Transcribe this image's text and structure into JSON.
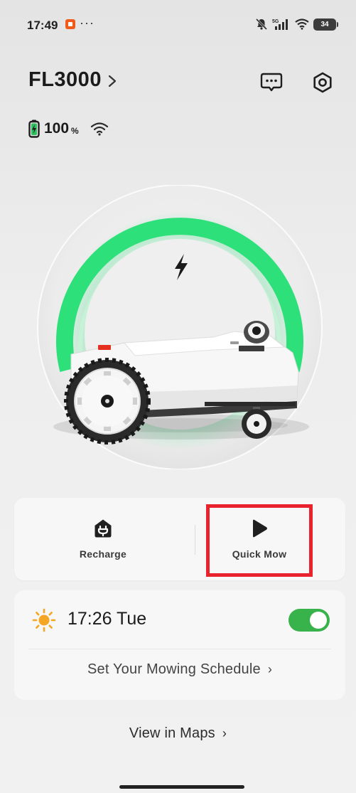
{
  "status_bar": {
    "time": "17:49",
    "overflow": "···",
    "network": "5G",
    "battery": "34"
  },
  "device": {
    "name": "FL3000",
    "chevron": "›",
    "battery_percent": "100",
    "battery_unit": "%",
    "battery_level": 1.0,
    "accent_color": "#2ee07a"
  },
  "actions": {
    "recharge_label": "Recharge",
    "quick_mow_label": "Quick Mow"
  },
  "schedule": {
    "time": "17:26",
    "day": "Tue",
    "time_display": "17:26  Tue",
    "enabled": true,
    "link_label": "Set Your Mowing Schedule",
    "link_chevron": "›"
  },
  "maps": {
    "link_label": "View in Maps",
    "link_chevron": "›"
  },
  "colors": {
    "highlight": "#e8232e",
    "toggle_on": "#38b24a",
    "sun": "#f5a623"
  },
  "icons": {
    "message": "message-icon",
    "settings": "settings-icon",
    "battery": "battery-charging-icon",
    "wifi": "wifi-icon",
    "recharge": "recharge-home-icon",
    "quick_mow": "play-icon",
    "sun": "sun-icon",
    "charging": "lightning-icon"
  }
}
